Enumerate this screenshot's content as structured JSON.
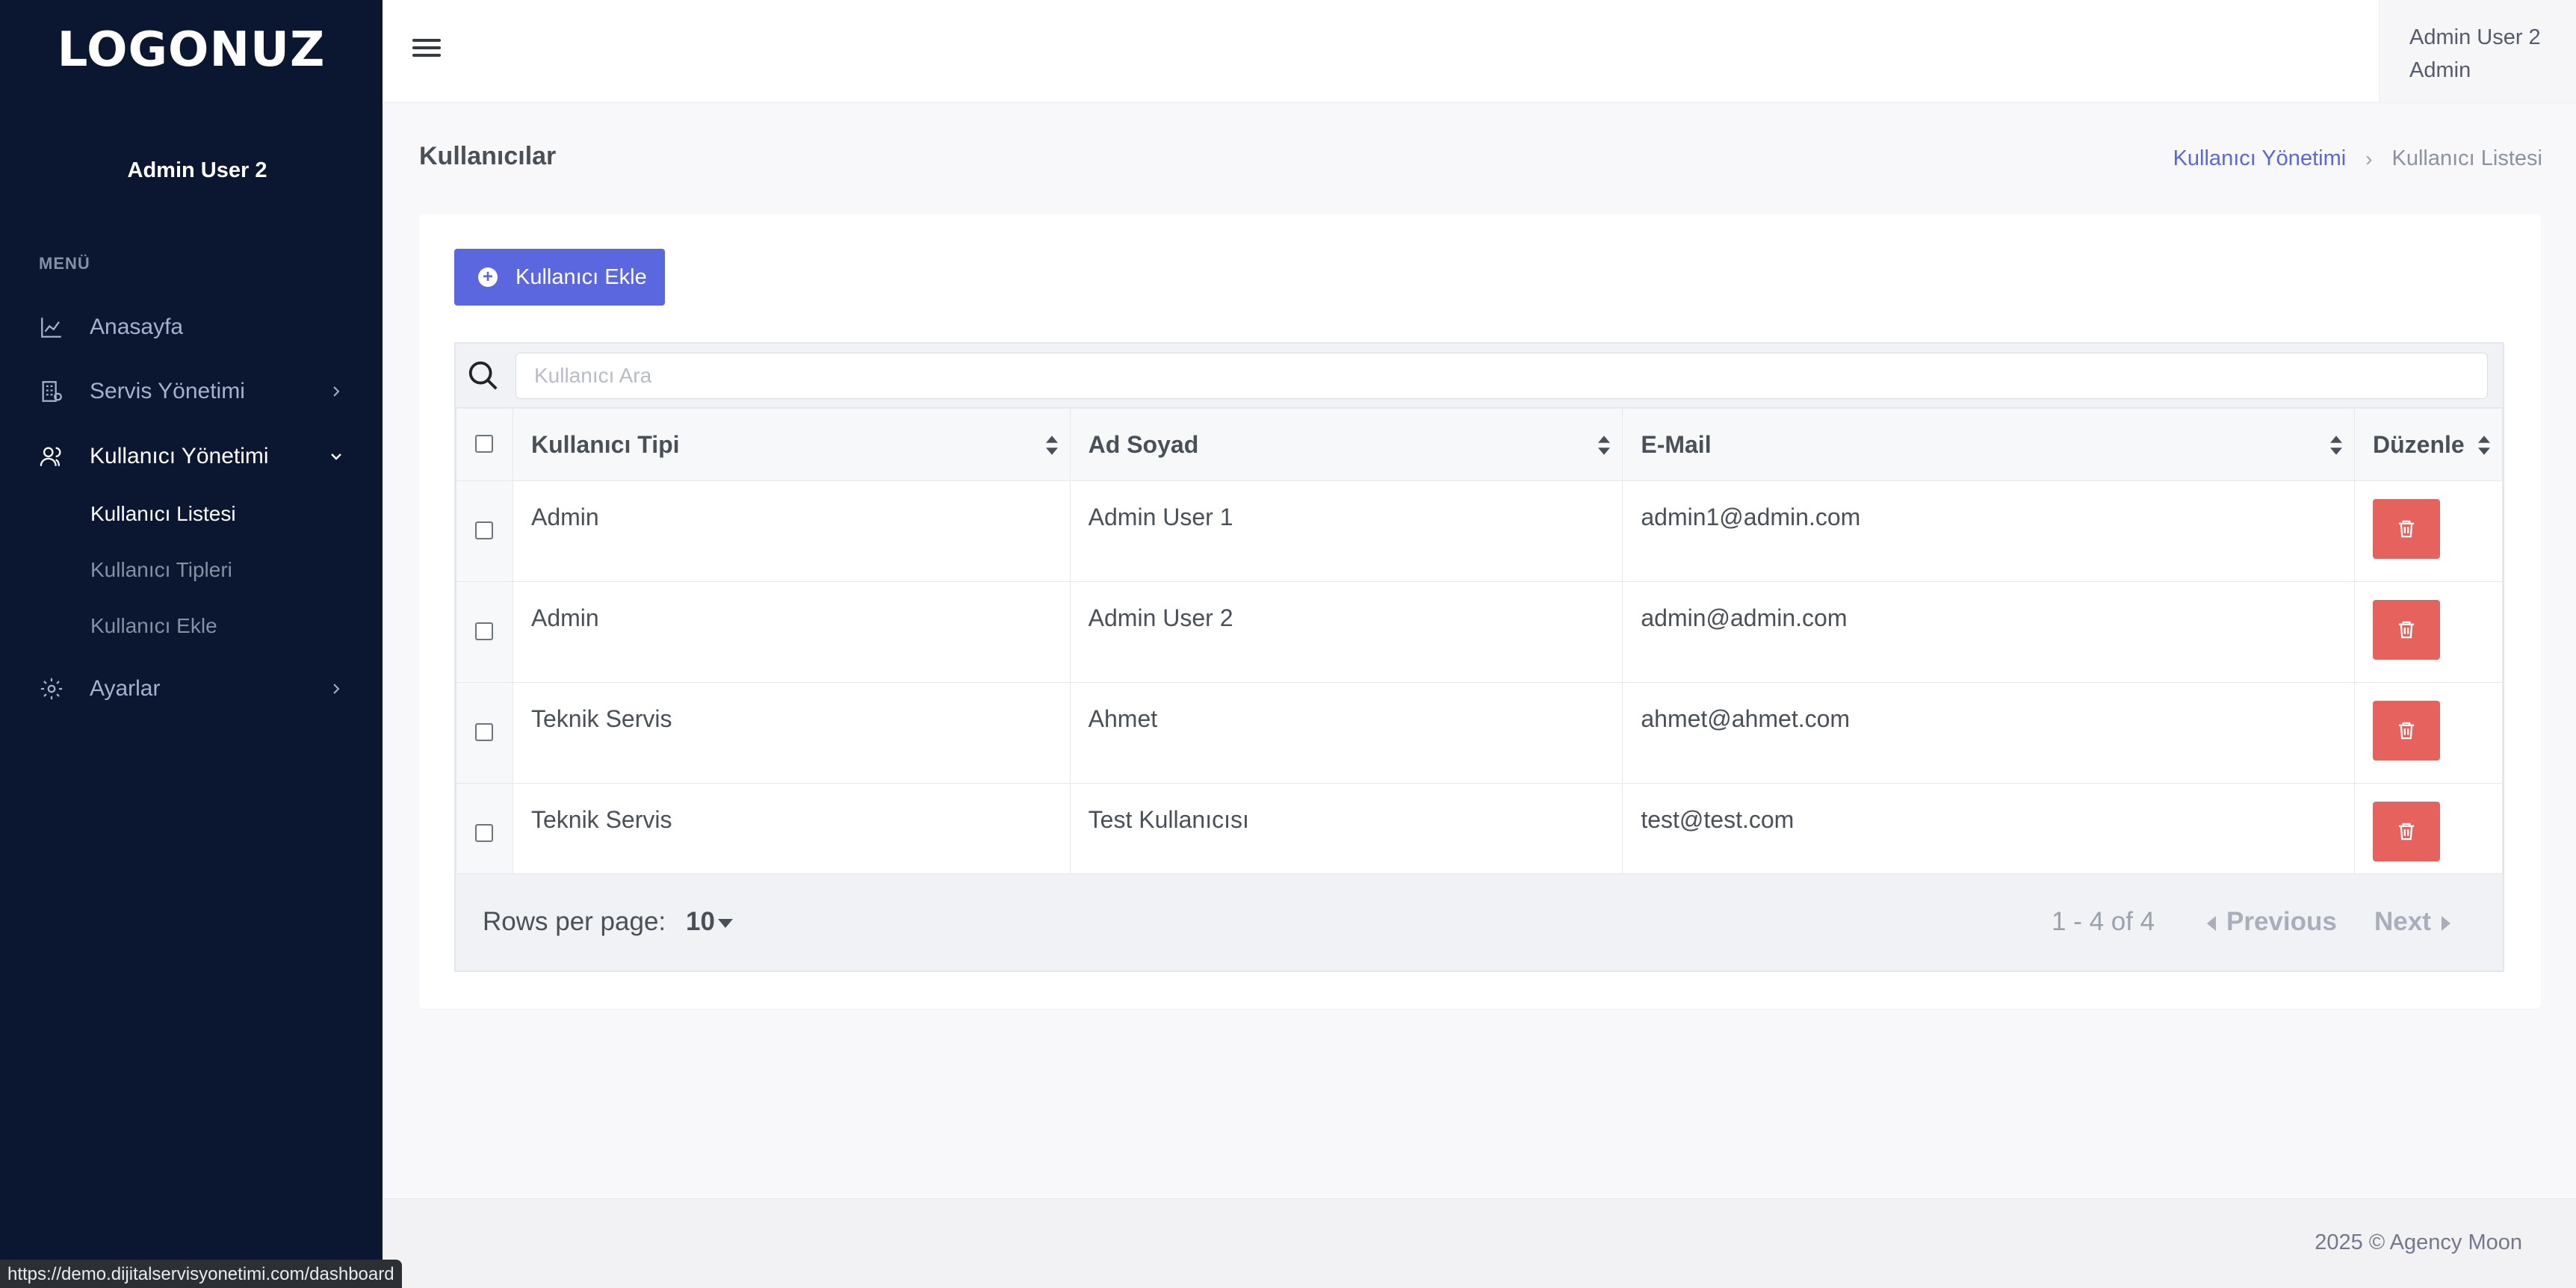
{
  "brand": {
    "logo_text": "LOGONUZ"
  },
  "sidebar": {
    "user_name": "Admin User 2",
    "menu_title": "MENÜ",
    "items": [
      {
        "label": "Anasayfa",
        "icon": "chart-line-icon"
      },
      {
        "label": "Servis Yönetimi",
        "icon": "building-icon"
      },
      {
        "label": "Kullanıcı Yönetimi",
        "icon": "users-icon"
      },
      {
        "label": "Ayarlar",
        "icon": "gear-icon"
      }
    ],
    "subitems": [
      {
        "label": "Kullanıcı Listesi"
      },
      {
        "label": "Kullanıcı Tipleri"
      },
      {
        "label": "Kullanıcı Ekle"
      }
    ]
  },
  "topbar": {
    "user_name": "Admin User 2",
    "user_role": "Admin"
  },
  "page": {
    "title": "Kullanıcılar",
    "breadcrumb": {
      "parent": "Kullanıcı Yönetimi",
      "current": "Kullanıcı Listesi"
    }
  },
  "toolbar": {
    "add_label": "Kullanıcı Ekle"
  },
  "search": {
    "placeholder": "Kullanıcı Ara"
  },
  "table": {
    "columns": [
      "Kullanıcı Tipi",
      "Ad Soyad",
      "E-Mail",
      "Düzenle"
    ],
    "rows": [
      {
        "type": "Admin",
        "name": "Admin User 1",
        "email": "admin1@admin.com"
      },
      {
        "type": "Admin",
        "name": "Admin User 2",
        "email": "admin@admin.com"
      },
      {
        "type": "Teknik Servis",
        "name": "Ahmet",
        "email": "ahmet@ahmet.com"
      },
      {
        "type": "Teknik Servis",
        "name": "Test Kullanıcısı",
        "email": "test@test.com"
      }
    ]
  },
  "pagination": {
    "rows_per_page_label": "Rows per page:",
    "rows_per_page_value": "10",
    "range": "1 - 4 of 4",
    "prev_label": "Previous",
    "next_label": "Next"
  },
  "footer": {
    "text": "2025 © Agency Moon"
  },
  "status_bar": {
    "url": "https://demo.dijitalservisyonetimi.com/dashboard"
  },
  "colors": {
    "sidebar_bg": "#0b1731",
    "primary": "#5b67de",
    "danger": "#e6635d",
    "link": "#5b66d9"
  }
}
